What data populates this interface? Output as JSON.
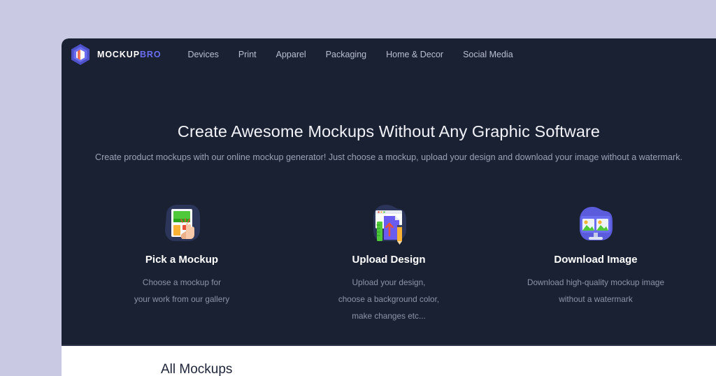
{
  "theme": {
    "page_background": "#c9c9e3",
    "hero_background": "#1a2133",
    "accent": "#6a6df0",
    "text_light": "#ffffff",
    "text_muted": "#8d94a8",
    "content_background": "#ffffff"
  },
  "header": {
    "logo_icon": "hexagon-cube-logo-icon",
    "brand_part1": "MOCKUP",
    "brand_part2": "BRO",
    "nav_items": [
      {
        "label": "Devices"
      },
      {
        "label": "Print"
      },
      {
        "label": "Apparel"
      },
      {
        "label": "Packaging"
      },
      {
        "label": "Home & Decor"
      },
      {
        "label": "Social Media"
      }
    ]
  },
  "hero": {
    "title": "Create Awesome Mockups Without Any Graphic Software",
    "subtitle": "Create product mockups with our online mockup generator! Just choose a mockup, upload your design and download your image without a watermark."
  },
  "features": [
    {
      "icon": "pick-a-mockup-icon",
      "title": "Pick a Mockup",
      "lines": [
        "Choose a mockup for",
        "your work from our gallery"
      ]
    },
    {
      "icon": "upload-design-icon",
      "title": "Upload Design",
      "lines": [
        "Upload your design,",
        "choose a background color,",
        "make changes etc..."
      ]
    },
    {
      "icon": "download-image-icon",
      "title": "Download Image",
      "lines": [
        "Download high-quality mockup image",
        "without a watermark"
      ]
    }
  ],
  "content": {
    "section_title": "All Mockups"
  }
}
